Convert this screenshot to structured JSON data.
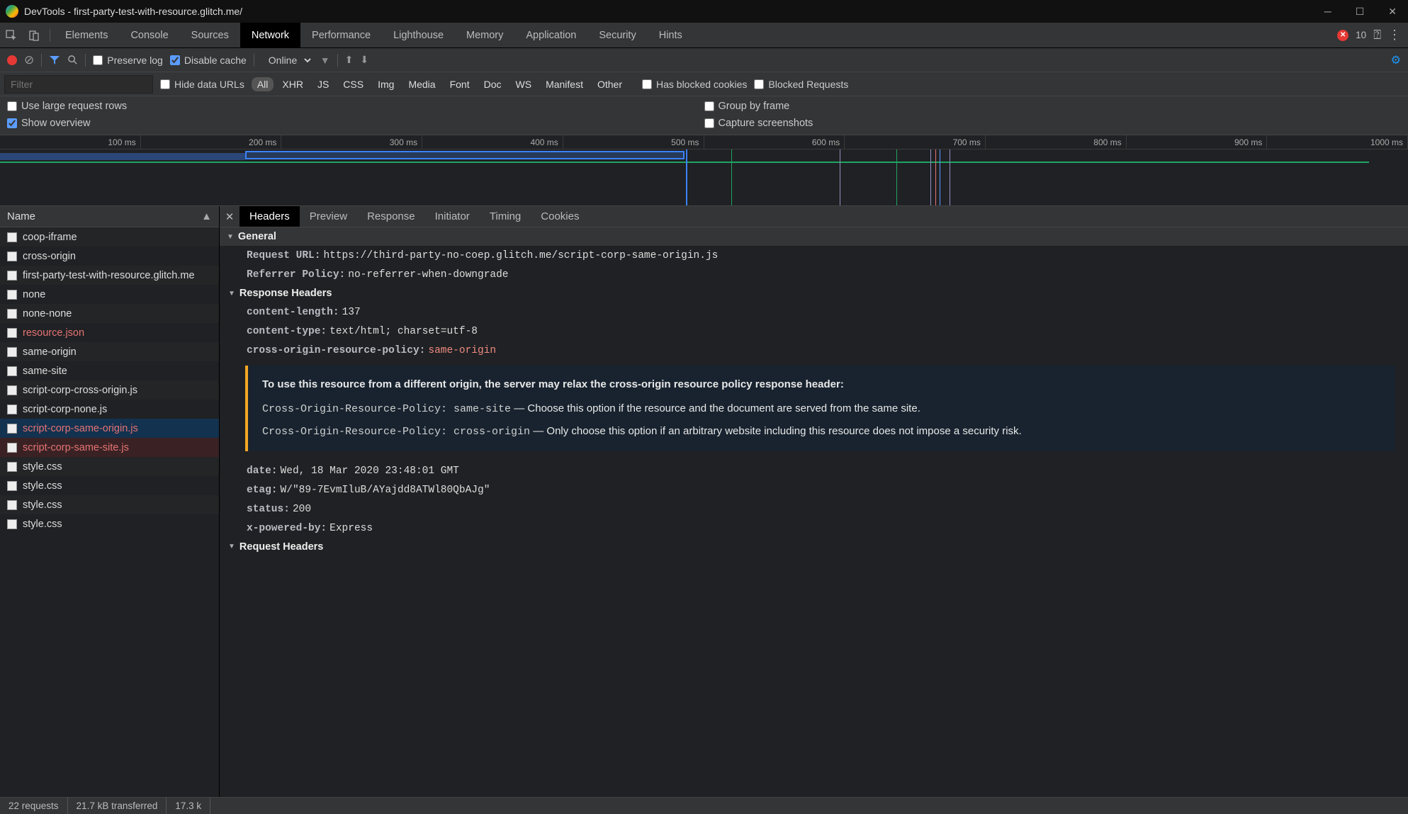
{
  "title": "DevTools - first-party-test-with-resource.glitch.me/",
  "tabbar": {
    "tabs": [
      "Elements",
      "Console",
      "Sources",
      "Network",
      "Performance",
      "Lighthouse",
      "Memory",
      "Application",
      "Security",
      "Hints"
    ],
    "active": "Network",
    "error_count": "10"
  },
  "toolbar": {
    "preserve_log": "Preserve log",
    "disable_cache": "Disable cache",
    "throttle": "Online"
  },
  "filterbar": {
    "placeholder": "Filter",
    "hide_data": "Hide data URLs",
    "types": [
      "All",
      "XHR",
      "JS",
      "CSS",
      "Img",
      "Media",
      "Font",
      "Doc",
      "WS",
      "Manifest",
      "Other"
    ],
    "active_type": "All",
    "has_blocked": "Has blocked cookies",
    "blocked_req": "Blocked Requests"
  },
  "opts": {
    "large_rows": "Use large request rows",
    "group_frame": "Group by frame",
    "show_overview": "Show overview",
    "capture_ss": "Capture screenshots"
  },
  "timeline_ticks": [
    "100 ms",
    "200 ms",
    "300 ms",
    "400 ms",
    "500 ms",
    "600 ms",
    "700 ms",
    "800 ms",
    "900 ms",
    "1000 ms"
  ],
  "name_col": "Name",
  "requests": [
    {
      "name": "coop-iframe",
      "err": false
    },
    {
      "name": "cross-origin",
      "err": false
    },
    {
      "name": "first-party-test-with-resource.glitch.me",
      "err": false
    },
    {
      "name": "none",
      "err": false
    },
    {
      "name": "none-none",
      "err": false
    },
    {
      "name": "resource.json",
      "err": true
    },
    {
      "name": "same-origin",
      "err": false
    },
    {
      "name": "same-site",
      "err": false
    },
    {
      "name": "script-corp-cross-origin.js",
      "err": false
    },
    {
      "name": "script-corp-none.js",
      "err": false
    },
    {
      "name": "script-corp-same-origin.js",
      "err": true,
      "sel": true
    },
    {
      "name": "script-corp-same-site.js",
      "err": true,
      "hover": true
    },
    {
      "name": "style.css",
      "err": false
    },
    {
      "name": "style.css",
      "err": false
    },
    {
      "name": "style.css",
      "err": false
    },
    {
      "name": "style.css",
      "err": false
    }
  ],
  "detail_tabs": [
    "Headers",
    "Preview",
    "Response",
    "Initiator",
    "Timing",
    "Cookies"
  ],
  "detail_active": "Headers",
  "sections": {
    "general": "General",
    "response_headers": "Response Headers",
    "request_headers": "Request Headers"
  },
  "general": {
    "url_k": "Request URL:",
    "url_v": "https://third-party-no-coep.glitch.me/script-corp-same-origin.js",
    "ref_k": "Referrer Policy:",
    "ref_v": "no-referrer-when-downgrade"
  },
  "resp": {
    "cl_k": "content-length:",
    "cl_v": "137",
    "ct_k": "content-type:",
    "ct_v": "text/html; charset=utf-8",
    "corp_k": "cross-origin-resource-policy:",
    "corp_v": "same-origin",
    "date_k": "date:",
    "date_v": "Wed, 18 Mar 2020 23:48:01 GMT",
    "etag_k": "etag:",
    "etag_v": "W/\"89-7EvmIluB/AYajdd8ATWl80QbAJg\"",
    "st_k": "status:",
    "st_v": "200",
    "xp_k": "x-powered-by:",
    "xp_v": "Express"
  },
  "corp_note": {
    "title": "To use this resource from a different origin, the server may relax the cross-origin resource policy response header:",
    "l1a": "Cross-Origin-Resource-Policy: same-site",
    "l1b": " — Choose this option if the resource and the document are served from the same site.",
    "l2a": "Cross-Origin-Resource-Policy: cross-origin",
    "l2b": " — Only choose this option if an arbitrary website including this resource does not impose a security risk."
  },
  "status": {
    "c1": "22 requests",
    "c2": "21.7 kB transferred",
    "c3": "17.3 k"
  }
}
